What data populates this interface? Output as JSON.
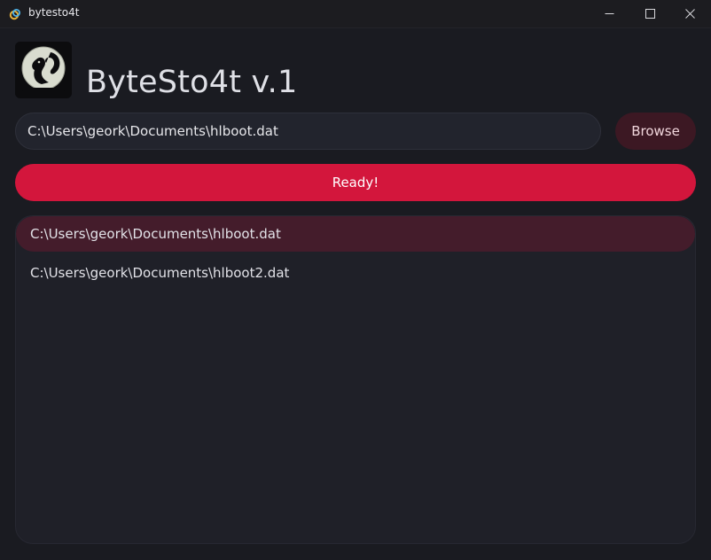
{
  "window": {
    "title": "bytesto4t",
    "controls": [
      "minimize-icon",
      "maximize-icon",
      "close-icon"
    ]
  },
  "header": {
    "logo": "squirrel-moon-logo",
    "app_title": "ByteSto4t v.1"
  },
  "path_input": {
    "value": "C:\\Users\\geork\\Documents\\hlboot.dat"
  },
  "browse_button": {
    "label": "Browse"
  },
  "status_button": {
    "label": "Ready!"
  },
  "file_list": {
    "items": [
      {
        "label": "C:\\Users\\geork\\Documents\\hlboot.dat",
        "selected": true
      },
      {
        "label": "C:\\Users\\geork\\Documents\\hlboot2.dat",
        "selected": false
      }
    ]
  },
  "colors": {
    "background": "#1a1b21",
    "accent": "#d3163c",
    "browse_bg": "#3c1823",
    "selected_row": "#441c2b"
  }
}
